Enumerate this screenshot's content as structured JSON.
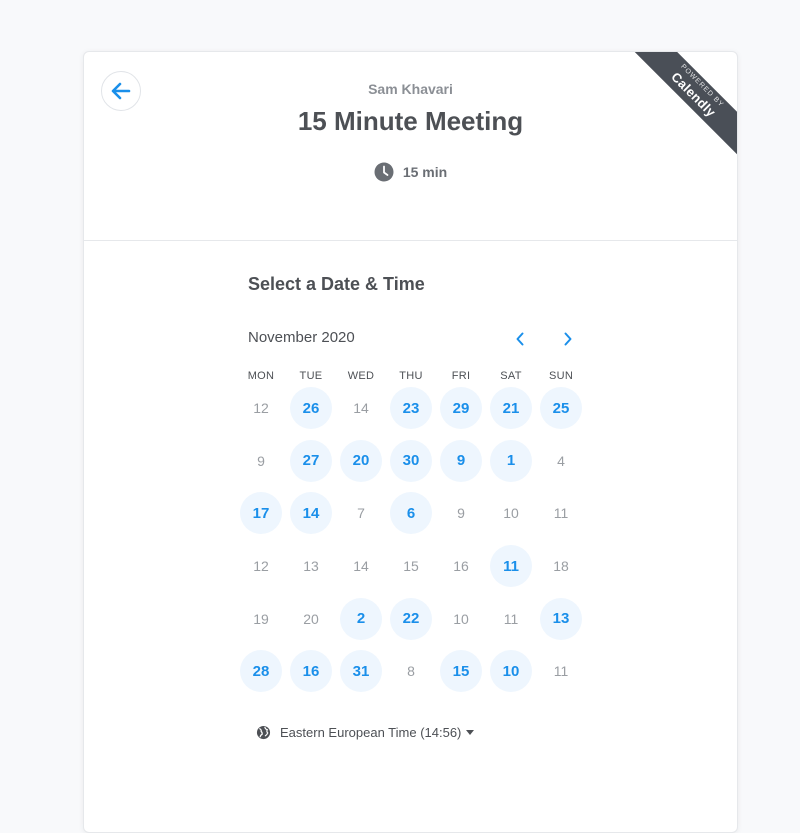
{
  "colors": {
    "accent": "#1a8fea",
    "available_bg": "#eef6fe",
    "ribbon_bg": "#4a4f57"
  },
  "header": {
    "host": "Sam Khavari",
    "title": "15 Minute Meeting",
    "duration": "15 min",
    "ribbon_small": "POWERED BY",
    "ribbon_big": "Calendly"
  },
  "scheduler": {
    "section_title": "Select a Date & Time",
    "month": "November 2020",
    "weekdays": [
      "MON",
      "TUE",
      "WED",
      "THU",
      "FRI",
      "SAT",
      "SUN"
    ],
    "weeks": [
      [
        {
          "d": "12",
          "a": false
        },
        {
          "d": "26",
          "a": true
        },
        {
          "d": "14",
          "a": false
        },
        {
          "d": "23",
          "a": true
        },
        {
          "d": "29",
          "a": true
        },
        {
          "d": "21",
          "a": true
        },
        {
          "d": "25",
          "a": true
        }
      ],
      [
        {
          "d": "9",
          "a": false
        },
        {
          "d": "27",
          "a": true
        },
        {
          "d": "20",
          "a": true
        },
        {
          "d": "30",
          "a": true
        },
        {
          "d": "9",
          "a": true
        },
        {
          "d": "1",
          "a": true
        },
        {
          "d": "4",
          "a": false
        }
      ],
      [
        {
          "d": "17",
          "a": true
        },
        {
          "d": "14",
          "a": true
        },
        {
          "d": "7",
          "a": false
        },
        {
          "d": "6",
          "a": true
        },
        {
          "d": "9",
          "a": false
        },
        {
          "d": "10",
          "a": false
        },
        {
          "d": "11",
          "a": false
        }
      ],
      [
        {
          "d": "12",
          "a": false
        },
        {
          "d": "13",
          "a": false
        },
        {
          "d": "14",
          "a": false
        },
        {
          "d": "15",
          "a": false
        },
        {
          "d": "16",
          "a": false
        },
        {
          "d": "11",
          "a": true
        },
        {
          "d": "18",
          "a": false
        }
      ],
      [
        {
          "d": "19",
          "a": false
        },
        {
          "d": "20",
          "a": false
        },
        {
          "d": "2",
          "a": true
        },
        {
          "d": "22",
          "a": true
        },
        {
          "d": "10",
          "a": false
        },
        {
          "d": "11",
          "a": false
        },
        {
          "d": "13",
          "a": true
        }
      ],
      [
        {
          "d": "28",
          "a": true
        },
        {
          "d": "16",
          "a": true
        },
        {
          "d": "31",
          "a": true
        },
        {
          "d": "8",
          "a": false
        },
        {
          "d": "15",
          "a": true
        },
        {
          "d": "10",
          "a": true
        },
        {
          "d": "11",
          "a": false
        }
      ]
    ],
    "timezone": "Eastern European Time (14:56)"
  },
  "icons": {
    "back": "arrow-left-icon",
    "clock": "clock-icon",
    "prev": "chevron-left-icon",
    "next": "chevron-right-icon",
    "globe": "globe-icon",
    "caret": "caret-down-icon"
  }
}
